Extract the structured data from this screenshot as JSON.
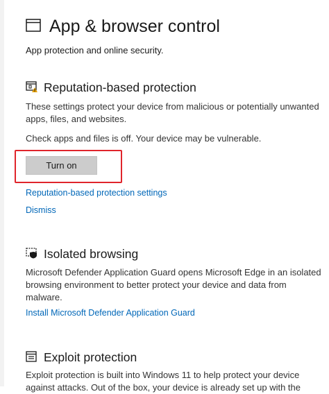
{
  "header": {
    "title": "App & browser control",
    "subtitle": "App protection and online security.",
    "icon": "browser-window-icon"
  },
  "reputation": {
    "title": "Reputation-based protection",
    "icon": "reputation-shield-icon",
    "description": "These settings protect your device from malicious or potentially unwanted apps, files, and websites.",
    "status": "Check apps and files is off. Your device may be vulnerable.",
    "button_label": "Turn on",
    "settings_link": "Reputation-based protection settings",
    "dismiss_link": "Dismiss",
    "highlight_color": "#e0242b"
  },
  "isolated": {
    "title": "Isolated browsing",
    "icon": "isolated-browsing-icon",
    "description": "Microsoft Defender Application Guard opens Microsoft Edge in an isolated browsing environment to better protect your device and data from malware.",
    "install_link": "Install Microsoft Defender Application Guard"
  },
  "exploit": {
    "title": "Exploit protection",
    "icon": "exploit-protection-icon",
    "description": "Exploit protection is built into Windows 11 to help protect your device against attacks. Out of the box, your device is already set up with the"
  },
  "colors": {
    "link": "#0067b8",
    "button_bg": "#cccccc",
    "warning": "#e8a200"
  }
}
